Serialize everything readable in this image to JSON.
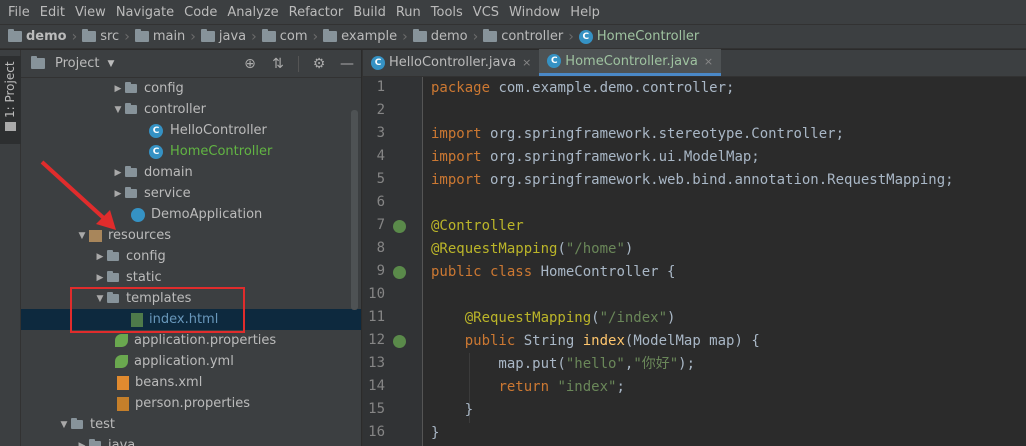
{
  "menu": [
    "File",
    "Edit",
    "View",
    "Navigate",
    "Code",
    "Analyze",
    "Refactor",
    "Build",
    "Run",
    "Tools",
    "VCS",
    "Window",
    "Help"
  ],
  "breadcrumb": {
    "project": "demo",
    "path": [
      "src",
      "main",
      "java",
      "com",
      "example",
      "demo",
      "controller"
    ],
    "file": "HomeController"
  },
  "side_tab": {
    "label": "1: Project"
  },
  "project_panel": {
    "title": "Project",
    "tree": [
      {
        "label": "config",
        "kind": "folder",
        "arrow": "collapsed"
      },
      {
        "label": "controller",
        "kind": "folder",
        "arrow": "expanded"
      },
      {
        "label": "HelloController",
        "kind": "class"
      },
      {
        "label": "HomeController",
        "kind": "class-active"
      },
      {
        "label": "domain",
        "kind": "folder",
        "arrow": "collapsed"
      },
      {
        "label": "service",
        "kind": "folder",
        "arrow": "collapsed"
      },
      {
        "label": "DemoApplication",
        "kind": "app"
      },
      {
        "label": "resources",
        "kind": "resources",
        "arrow": "expanded"
      },
      {
        "label": "config",
        "kind": "folder",
        "arrow": "collapsed"
      },
      {
        "label": "static",
        "kind": "folder",
        "arrow": "collapsed"
      },
      {
        "label": "templates",
        "kind": "folder",
        "arrow": "expanded"
      },
      {
        "label": "index.html",
        "kind": "html"
      },
      {
        "label": "application.properties",
        "kind": "spring"
      },
      {
        "label": "application.yml",
        "kind": "spring"
      },
      {
        "label": "beans.xml",
        "kind": "xml"
      },
      {
        "label": "person.properties",
        "kind": "props"
      },
      {
        "label": "test",
        "kind": "folder",
        "arrow": "expanded"
      },
      {
        "label": "java",
        "kind": "folder",
        "arrow": "collapsed"
      }
    ]
  },
  "editor": {
    "tabs": [
      {
        "label": "HelloController.java",
        "active": false
      },
      {
        "label": "HomeController.java",
        "active": true
      }
    ],
    "line_numbers": [
      "1",
      "2",
      "3",
      "4",
      "5",
      "6",
      "7",
      "8",
      "9",
      "10",
      "11",
      "12",
      "13",
      "14",
      "15",
      "16"
    ]
  },
  "colors": {
    "keyword": "#cc7832",
    "annotation": "#bbb529",
    "string": "#6a8759",
    "method": "#ffc66d",
    "highlight_box": "#e02c2c"
  }
}
